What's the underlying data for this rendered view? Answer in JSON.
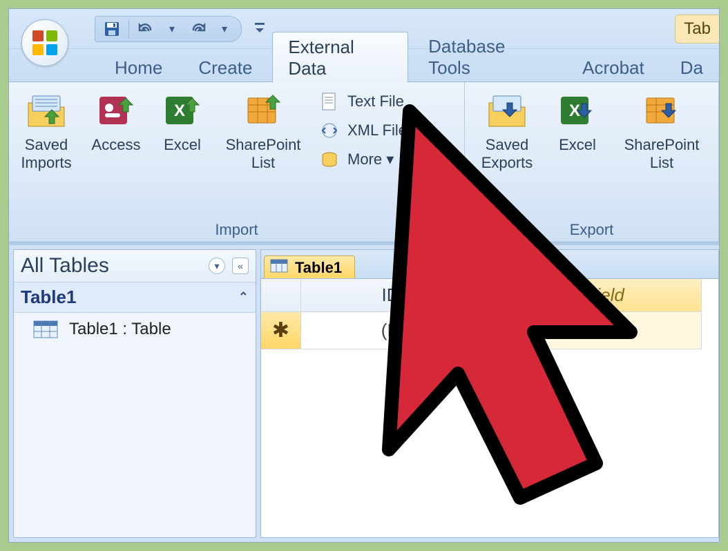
{
  "title_right": "Tab",
  "tabs": {
    "home": "Home",
    "create": "Create",
    "external_data": "External Data",
    "database_tools": "Database Tools",
    "acrobat": "Acrobat",
    "da": "Da"
  },
  "ribbon": {
    "import": {
      "saved_imports": "Saved\nImports",
      "access": "Access",
      "excel": "Excel",
      "sharepoint": "SharePoint\nList",
      "text_file": "Text File",
      "xml_file": "XML File",
      "more": "More",
      "label": "Import"
    },
    "export": {
      "saved_exports": "Saved\nExports",
      "excel": "Excel",
      "sharepoint": "SharePoint\nList",
      "label": "Export"
    }
  },
  "nav": {
    "header": "All Tables",
    "group": "Table1",
    "item": "Table1 : Table"
  },
  "sheet": {
    "tab": "Table1",
    "col_id": "ID",
    "col_new": "ew Field",
    "new_row_marker": "✱",
    "new_value": "(N"
  }
}
